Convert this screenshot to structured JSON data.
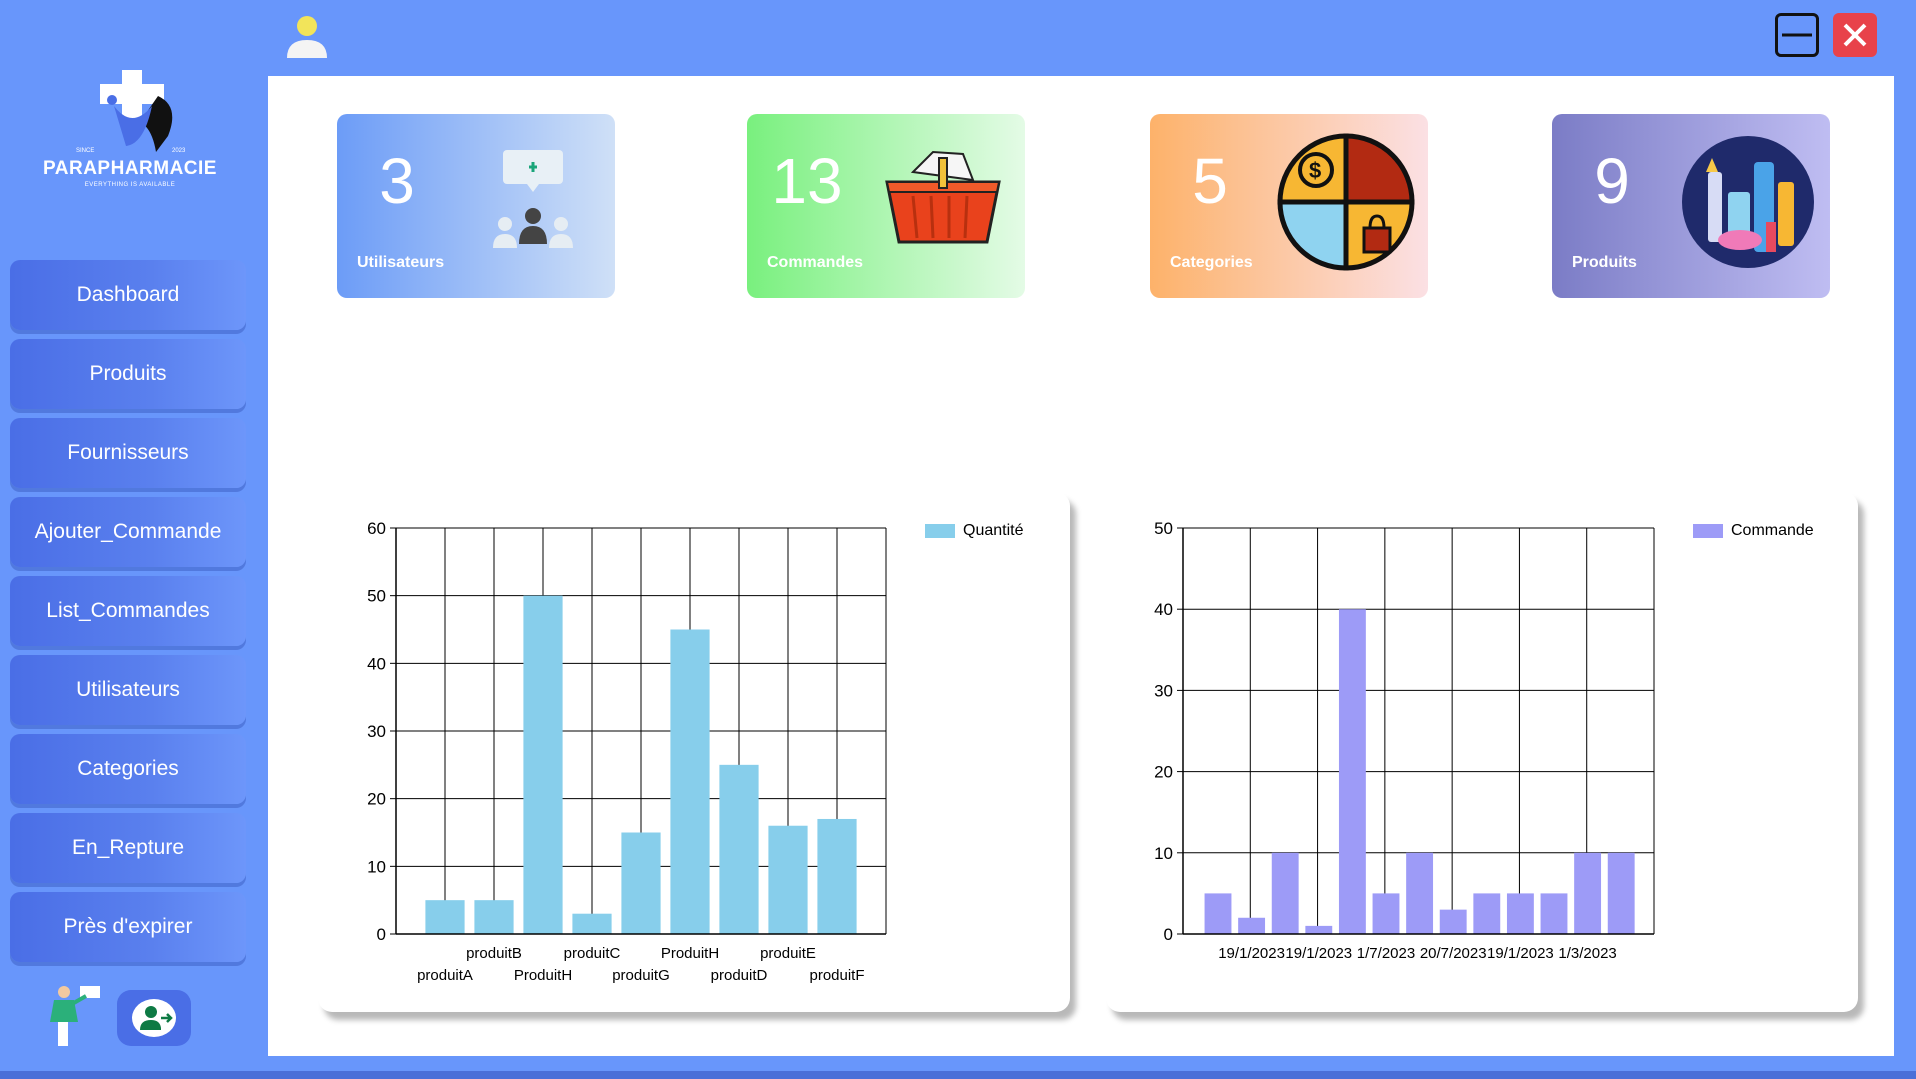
{
  "brand": {
    "name": "PARAPHARMACIE",
    "tagline": "EVERYTHING IS AVAILABLE",
    "since_left": "SINCE",
    "since_right": "2023"
  },
  "sidebar": {
    "items": [
      {
        "label": "Dashboard"
      },
      {
        "label": "Produits"
      },
      {
        "label": "Fournisseurs"
      },
      {
        "label": "Ajouter_Commande"
      },
      {
        "label": "List_Commandes"
      },
      {
        "label": "Utilisateurs"
      },
      {
        "label": "Categories"
      },
      {
        "label": "En_Repture"
      },
      {
        "label": "Près d'expirer"
      }
    ]
  },
  "cards": {
    "users": {
      "value": "3",
      "label": "Utilisateurs"
    },
    "orders": {
      "value": "13",
      "label": "Commandes"
    },
    "categories": {
      "value": "5",
      "label": "Categories"
    },
    "products": {
      "value": "9",
      "label": "Produits"
    }
  },
  "colors": {
    "qty_bar": "#87ceeb",
    "order_bar": "#9d9bf7",
    "close": "#e8424a",
    "accent": "#6896fb"
  },
  "chart_data": [
    {
      "type": "bar",
      "categories": [
        "produitA",
        "produitB",
        "ProduitH",
        "produitC",
        "produitG",
        "ProduitH",
        "produitD",
        "produitE",
        "produitF"
      ],
      "series": [
        {
          "name": "Quantité",
          "values": [
            5,
            5,
            50,
            3,
            15,
            45,
            25,
            16,
            17
          ]
        }
      ],
      "ylim": [
        0,
        60
      ],
      "yticks": [
        0,
        10,
        20,
        30,
        40,
        50,
        60
      ],
      "grid": true,
      "legend": "top-right"
    },
    {
      "type": "bar",
      "categories": [
        "",
        "19/1/2023",
        "",
        "19/1/2023",
        "",
        "1/7/2023",
        "",
        "20/7/2023",
        "",
        "19/1/2023",
        "",
        "1/3/2023",
        ""
      ],
      "series": [
        {
          "name": "Commande",
          "values": [
            5,
            2,
            10,
            1,
            40,
            5,
            10,
            3,
            5,
            5,
            5,
            10,
            10
          ]
        }
      ],
      "ylim": [
        0,
        50
      ],
      "yticks": [
        0,
        10,
        20,
        30,
        40,
        50
      ],
      "grid": true,
      "legend": "top-right"
    }
  ]
}
